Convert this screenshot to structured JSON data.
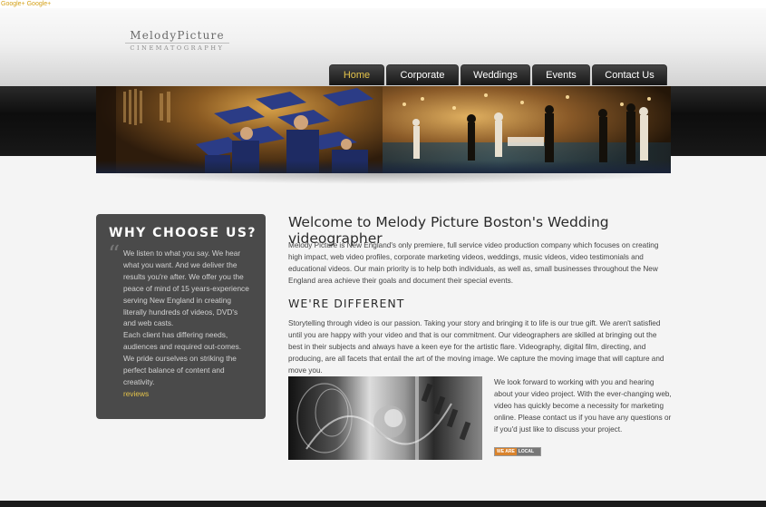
{
  "topline": {
    "text": "Google+ Google+"
  },
  "logo": {
    "name": "MelodyPicture",
    "tagline": "CINEMATOGRAPHY"
  },
  "nav": {
    "items": [
      {
        "label": "Home",
        "active": true
      },
      {
        "label": "Corporate"
      },
      {
        "label": "Weddings"
      },
      {
        "label": "Events"
      },
      {
        "label": "Contact Us"
      }
    ]
  },
  "colors": {
    "accent": "#e4c34a",
    "panel": "#4a4a4a",
    "dark_band": "#161616"
  },
  "why": {
    "title": "WHY CHOOSE US?",
    "text": [
      "We listen to what you say. We hear what you want.  And we deliver the results you're after. We offer you the peace of mind of 15 years-experience serving New England in creating literally hundreds of videos, DVD's and web casts.",
      "Each client has differing needs, audiences and required out-comes. We pride ourselves on striking the perfect balance of content and creativity."
    ],
    "link": "reviews"
  },
  "main": {
    "title": "Welcome to Melody Picture Boston's Wedding videographer",
    "intro": "Melody Picture is New England's only premiere, full service video production company which focuses on creating high impact, web video profiles, corporate marketing videos, weddings, music videos, video testimonials and educational videos. Our main priority is to help both individuals, as well as, small businesses throughout the New England area achieve their goals and document their special events.",
    "subtitle": "WE'RE DIFFERENT",
    "different": "Storytelling through video is our passion. Taking your story and bringing it to life is our true gift. We aren't satisfied until you are happy with your video and that is our commitment. Our videographers are skilled at bringing out the best in their subjects and always have a keen eye for the artistic flare. Videography, digital film, directing, and producing, are all facets that entail the art of the moving image. We capture the moving image that will capture and move you.",
    "closing": "We look forward to working with you and hearing about your video project. With the ever-changing web, video has quickly become a necessity for marketing online. Please contact us if you have any questions or if you'd just like to discuss your project.",
    "badge": [
      "WE ARE",
      "LOCAL"
    ]
  }
}
